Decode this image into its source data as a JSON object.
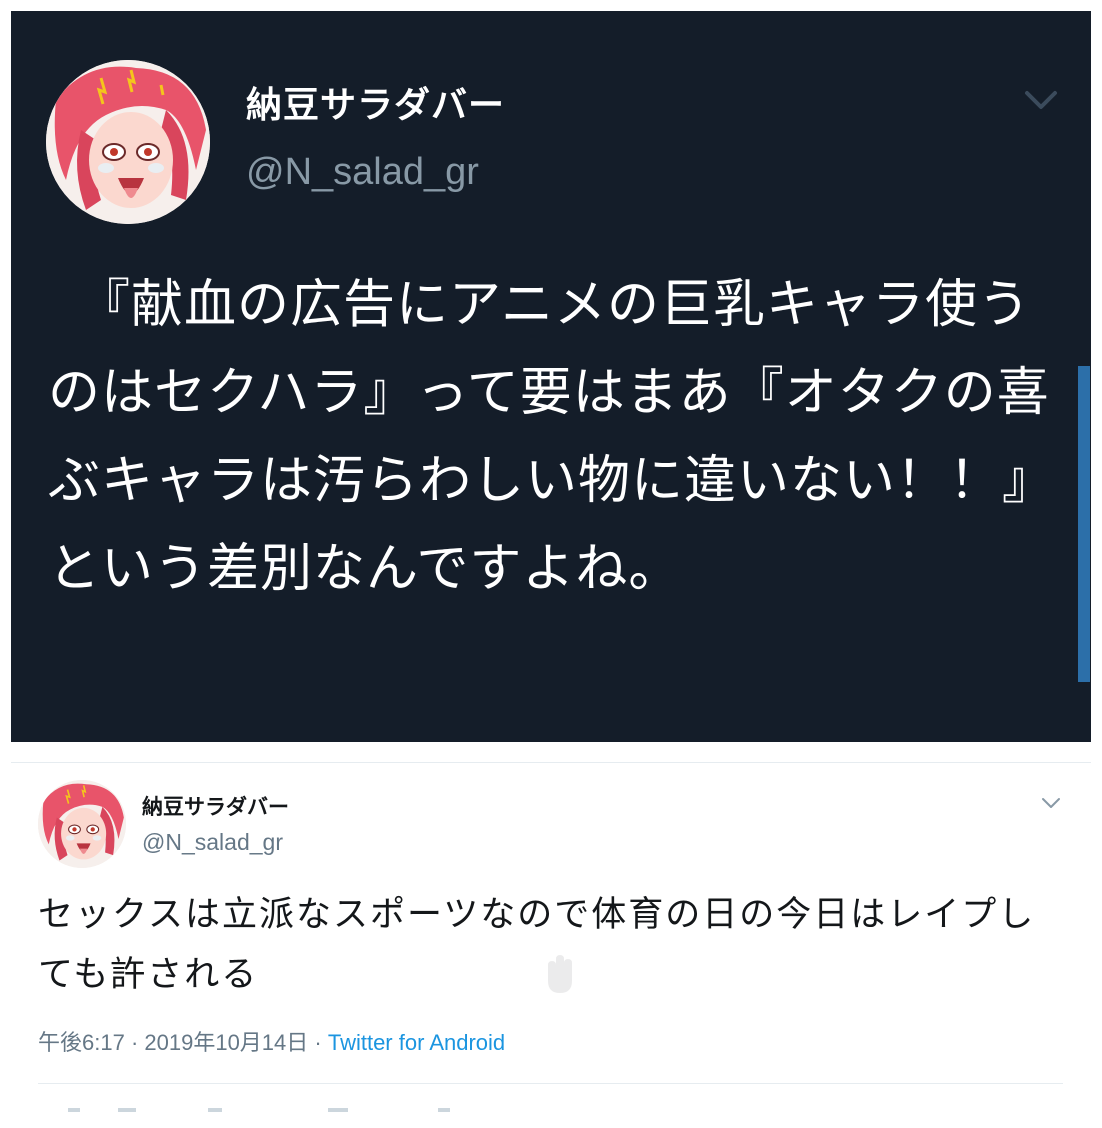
{
  "top_tweet": {
    "display_name": "納豆サラダバー",
    "handle": "@N_salad_gr",
    "text": "『献血の広告にアニメの巨乳キャラ使うのはセクハラ』って要はまあ『オタクの喜ぶキャラは汚らわしい物に違いない！！』という差別なんですよね。",
    "menu_icon": "chevron-down-icon",
    "theme": {
      "background": "#141d29",
      "text": "#ffffff",
      "handle": "#8899a6",
      "scroll": "#2c6fa9"
    }
  },
  "bottom_tweet": {
    "display_name": "納豆サラダバー",
    "handle": "@N_salad_gr",
    "text": "セックスは立派なスポーツなので体育の日の今日はレイプしても許される",
    "time": "午後6:17",
    "separator": " · ",
    "date": "2019年10月14日",
    "source": "Twitter for Android",
    "menu_icon": "chevron-down-icon",
    "theme": {
      "background": "#ffffff",
      "text": "#14171a",
      "meta": "#657786",
      "link": "#1b95e0"
    }
  }
}
